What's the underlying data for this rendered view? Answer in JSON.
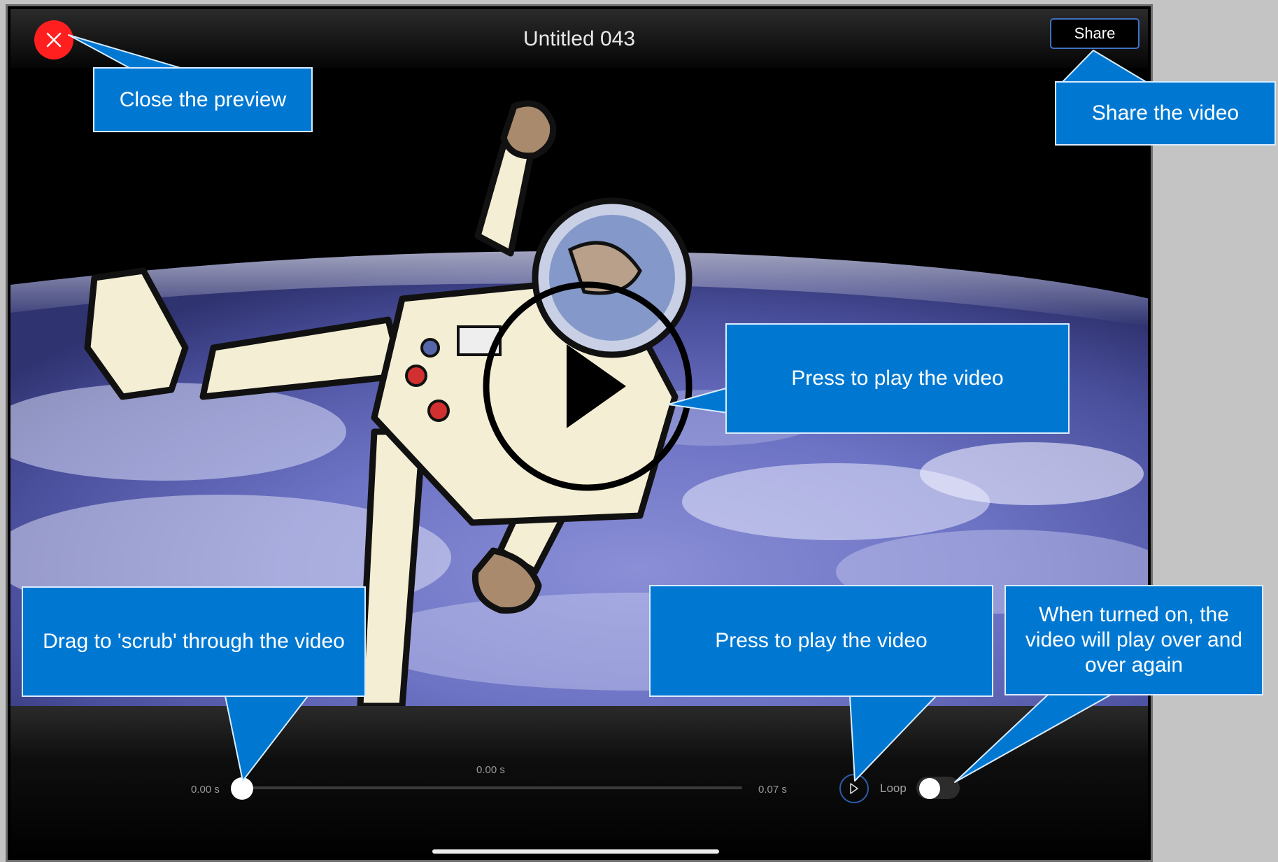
{
  "header": {
    "title": "Untitled 043",
    "share_label": "Share"
  },
  "player": {
    "current_time": "0.00 s",
    "start_time": "0.00 s",
    "end_time": "0.07 s",
    "loop_label": "Loop",
    "loop_on": false,
    "scrub_progress": 0.0
  },
  "callouts": {
    "close": "Close the preview",
    "share": "Share the video",
    "play_center": "Press to play the video",
    "scrub": "Drag to 'scrub' through the video",
    "play_small": "Press to play the video",
    "loop": "When turned on, the video will play over and over again"
  },
  "colors": {
    "close_button": "#ff1f1f",
    "callout": "#0078d2",
    "share_border": "#3f72c4"
  },
  "icons": {
    "close": "close-icon",
    "play": "play-icon"
  }
}
